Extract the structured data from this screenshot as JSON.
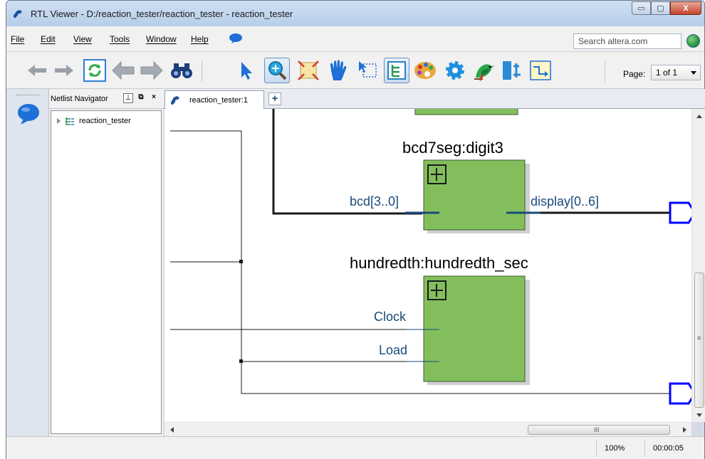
{
  "window": {
    "title": "RTL Viewer - D:/reaction_tester/reaction_tester - reaction_tester",
    "minimize": "▭",
    "maximize": "▢",
    "close": "X"
  },
  "menu": {
    "items": [
      "File",
      "Edit",
      "View",
      "Tools",
      "Window",
      "Help"
    ],
    "search_placeholder": "Search altera.com"
  },
  "toolbar": {
    "buttons": [
      "back-icon",
      "forward-icon",
      "refresh-icon",
      "back-arrow-icon",
      "forward-arrow-icon",
      "binoculars-icon",
      "select-pointer-icon",
      "zoom-icon",
      "fit-icon",
      "hand-icon",
      "selection-rect-icon",
      "hierarchy-icon",
      "palette-icon",
      "gear-icon",
      "bird-icon",
      "network-icon",
      "flow-icon"
    ],
    "page_label": "Page:",
    "page_value": "1 of 1"
  },
  "navigator": {
    "title": "Netlist Navigator",
    "tree_items": [
      "reaction_tester"
    ]
  },
  "tabs": [
    {
      "label": "reaction_tester:1"
    }
  ],
  "schematic": {
    "blocks": [
      {
        "name": "bcd7seg:digit3",
        "inputs": [
          "bcd[3..0]"
        ],
        "outputs": [
          "display[0..6]"
        ]
      },
      {
        "name": "hundredth:hundredth_sec",
        "inputs": [
          "Clock",
          "Load"
        ],
        "outputs": []
      }
    ],
    "block_color": "#82bf5c",
    "bus_color": "#1b4a7a",
    "output_port_color": "#0000ff"
  },
  "scrollbar": {
    "grip": "III",
    "vgrip": "≡"
  },
  "status": {
    "zoom": "100%",
    "time": "00:00:05"
  }
}
